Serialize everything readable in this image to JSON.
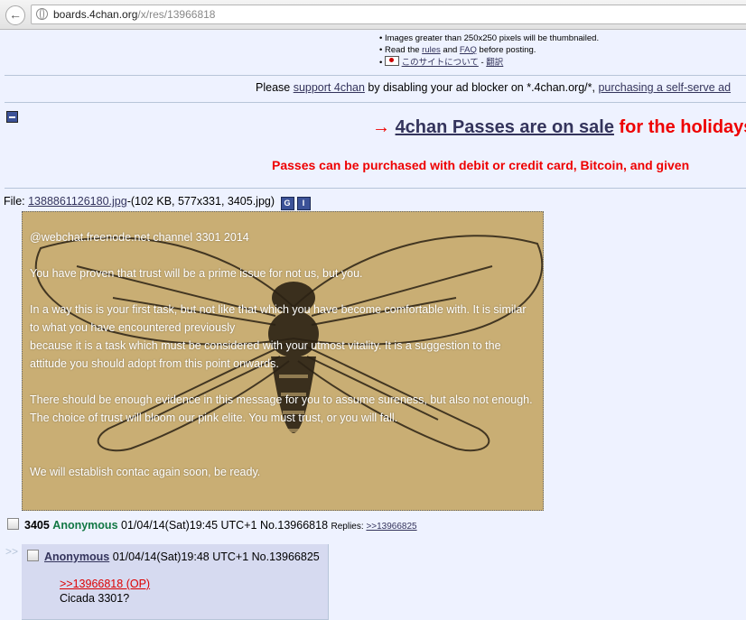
{
  "browser": {
    "url_host": "boards.4chan.org",
    "url_path": "/x/res/13966818"
  },
  "rules": {
    "line1": "Images greater than 250x250 pixels will be thumbnailed.",
    "line2_pre": "Read the ",
    "rules_link": "rules",
    "line2_mid": " and ",
    "faq_link": "FAQ",
    "line2_post": " before posting.",
    "jp_link": "このサイトについて",
    "jp_sep": " - ",
    "jp_link2": "翻訳"
  },
  "adblock": {
    "pre": "Please ",
    "support_link": "support 4chan",
    "mid": " by disabling your ad blocker on *.4chan.org/*, ",
    "purchase_link": "purchasing a self-serve ad"
  },
  "promo": {
    "arrow": "→ ",
    "link": "4chan Passes are on sale",
    "tail": " for the holidays",
    "line2": "Passes can be purchased with debit or credit card, Bitcoin, and given"
  },
  "file": {
    "label": "File: ",
    "name": "1388861126180.jpg",
    "info": "-(102 KB, 577x331, 3405.jpg)",
    "icon_g": "G",
    "icon_i": "I"
  },
  "image_text": {
    "line1": "@webchat.freenode.net  channel 3301 2014",
    "line2": "You have proven that trust will be a prime issue for not us, but you.",
    "line3": "In a way this is your first task, but not like that which you have become comfortable with. It is similar to what you have encountered previously",
    "line4": "because it is a task which must be considered with your utmost vitality. It is a suggestion to the attitude you should adopt from this point onwards.",
    "line5": "There should be enough evidence in this message for you to assume sureness, but also not enough.",
    "line6": "The choice of trust will bloom our pink elite. You must trust, or you will fall.",
    "line7": "We will establish contac again soon, be ready."
  },
  "op": {
    "subject": "3405",
    "name": "Anonymous",
    "datetime": "01/04/14(Sat)19:45 UTC+1",
    "number": "No.13966818",
    "replies_label": "Replies:",
    "reply_link": ">>13966825"
  },
  "reply": {
    "arrows": ">>",
    "name": "Anonymous",
    "datetime": "01/04/14(Sat)19:48 UTC+1",
    "number": "No.13966825",
    "quote": ">>13966818 (OP)",
    "text": "Cicada 3301?"
  },
  "colors": {
    "board_bg": "#eef2ff",
    "name_green": "#117743",
    "promo_red": "#e00000",
    "link_blue": "#34345c"
  }
}
